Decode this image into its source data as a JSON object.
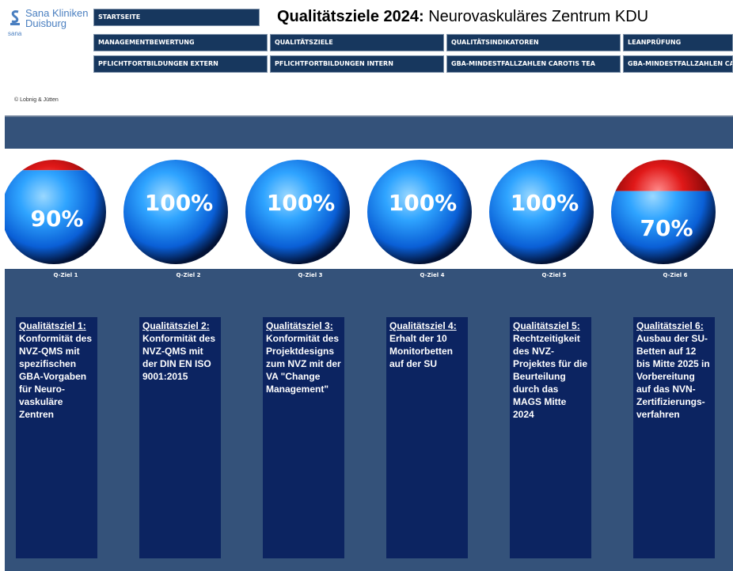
{
  "logo": {
    "line1": "Sana Kliniken",
    "line2": "Duisburg",
    "sub": "sana"
  },
  "title": {
    "bold": "Qualitätsziele 2024:",
    "rest": " Neurovaskuläres Zentrum KDU"
  },
  "nav": {
    "start": "STARTSEITE",
    "row1": [
      "MANAGEMENTBEWERTUNG",
      "QUALITÄTSZIELE",
      "QUALITÄTSINDIKATOREN",
      "LEANPRÜFUNG"
    ],
    "row2": [
      "PFLICHTFORTBILDUNGEN EXTERN",
      "PFLICHTFORTBILDUNGEN INTERN",
      "GBA-MINDESTFALLZAHLEN CAROTIS TEA",
      "GBA-MINDESTFALLZAHLEN CAROT"
    ]
  },
  "copyright": "© Lobnig & Jütten",
  "colors": {
    "navy": "#17375e",
    "band": "#34527a",
    "card": "#0c2461",
    "fill_blue": "#1e90ff",
    "empty_red": "#cc1111"
  },
  "goals": [
    {
      "label": "Q-Ziel 1",
      "percent_text": "90%",
      "fraction": 0.9,
      "title": "Qualitätsziel 1:",
      "text": "Konformität des NVZ-QMS mit spezifischen GBA-Vorgaben für Neuro-vaskuläre Zentren"
    },
    {
      "label": "Q-Ziel 2",
      "percent_text": "100%",
      "fraction": 1.0,
      "title": "Qualitätsziel 2:",
      "text": "Konformität des NVZ-QMS mit der DIN EN ISO 9001:2015"
    },
    {
      "label": "Q-Ziel 3",
      "percent_text": "100%",
      "fraction": 1.0,
      "title": "Qualitätsziel 3:",
      "text": "Konformität des Projektdesigns zum NVZ mit der VA \"Change Management\""
    },
    {
      "label": "Q-Ziel 4",
      "percent_text": "100%",
      "fraction": 1.0,
      "title": "Qualitätsziel 4:",
      "text": "Erhalt der 10 Monitorbetten auf der SU"
    },
    {
      "label": "Q-Ziel 5",
      "percent_text": "100%",
      "fraction": 1.0,
      "title": "Qualitätsziel 5:",
      "text": "Rechtzeitigkeit des NVZ-Projektes für die Beurteilung durch das MAGS Mitte 2024"
    },
    {
      "label": "Q-Ziel 6",
      "percent_text": "70%",
      "fraction": 0.7,
      "title": "Qualitätsziel 6:",
      "text": "Ausbau der SU-Betten auf 12 bis Mitte 2025 in Vorbereitung auf das NVN-Zertifizierungs-verfahren"
    }
  ]
}
